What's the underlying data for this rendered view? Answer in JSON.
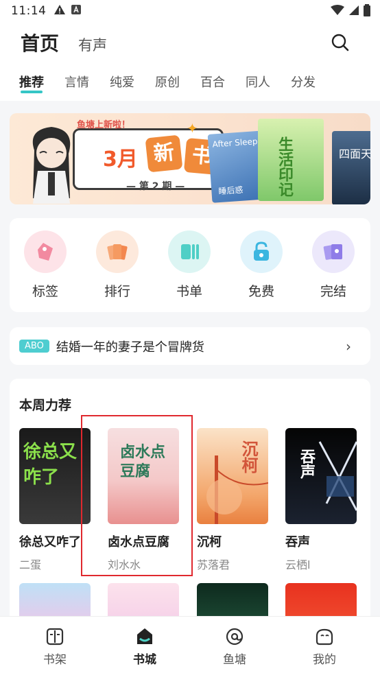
{
  "status": {
    "time": "11:14"
  },
  "header": {
    "main_tab": "首页",
    "second_tab": "有声",
    "categories": [
      "推荐",
      "言情",
      "纯爱",
      "原创",
      "百合",
      "同人",
      "分发"
    ]
  },
  "banner": {
    "sub": "鱼塘上新啦！",
    "month": "3月",
    "char1": "新",
    "char2": "书",
    "issue": "— 第 2 期 —",
    "cover1_text": "After Sleepin",
    "cover1_sub": "睡后惑",
    "cover2_text": "生活印记",
    "cover3_text": "四面天"
  },
  "quick": [
    {
      "label": "标签",
      "icon": "tag-icon",
      "color": "#fde3e8"
    },
    {
      "label": "排行",
      "icon": "ranking-icon",
      "color": "#fde9dc"
    },
    {
      "label": "书单",
      "icon": "booklist-icon",
      "color": "#dcf5f3"
    },
    {
      "label": "免费",
      "icon": "free-icon",
      "color": "#dff3fb"
    },
    {
      "label": "完结",
      "icon": "finished-icon",
      "color": "#ece8fb"
    }
  ],
  "notice": {
    "badge": "ABO",
    "text": "结婚一年的妻子是个冒牌货",
    "arrow": "›"
  },
  "recommend": {
    "title": "本周力荐",
    "books": [
      {
        "title": "徐总又咋了",
        "author": "二蛋",
        "cover_text": "徐总又咋了"
      },
      {
        "title": "卤水点豆腐",
        "author": "刘水水",
        "cover_text": "卤水点豆腐"
      },
      {
        "title": "沉柯",
        "author": "苏落君",
        "cover_text": "沉柯"
      },
      {
        "title": "吞声",
        "author": "云栖l",
        "cover_text": "吞声"
      }
    ]
  },
  "nav": [
    {
      "label": "书架",
      "icon": "bookshelf-icon"
    },
    {
      "label": "书城",
      "icon": "bookstore-icon"
    },
    {
      "label": "鱼塘",
      "icon": "pond-icon"
    },
    {
      "label": "我的",
      "icon": "profile-icon"
    }
  ]
}
